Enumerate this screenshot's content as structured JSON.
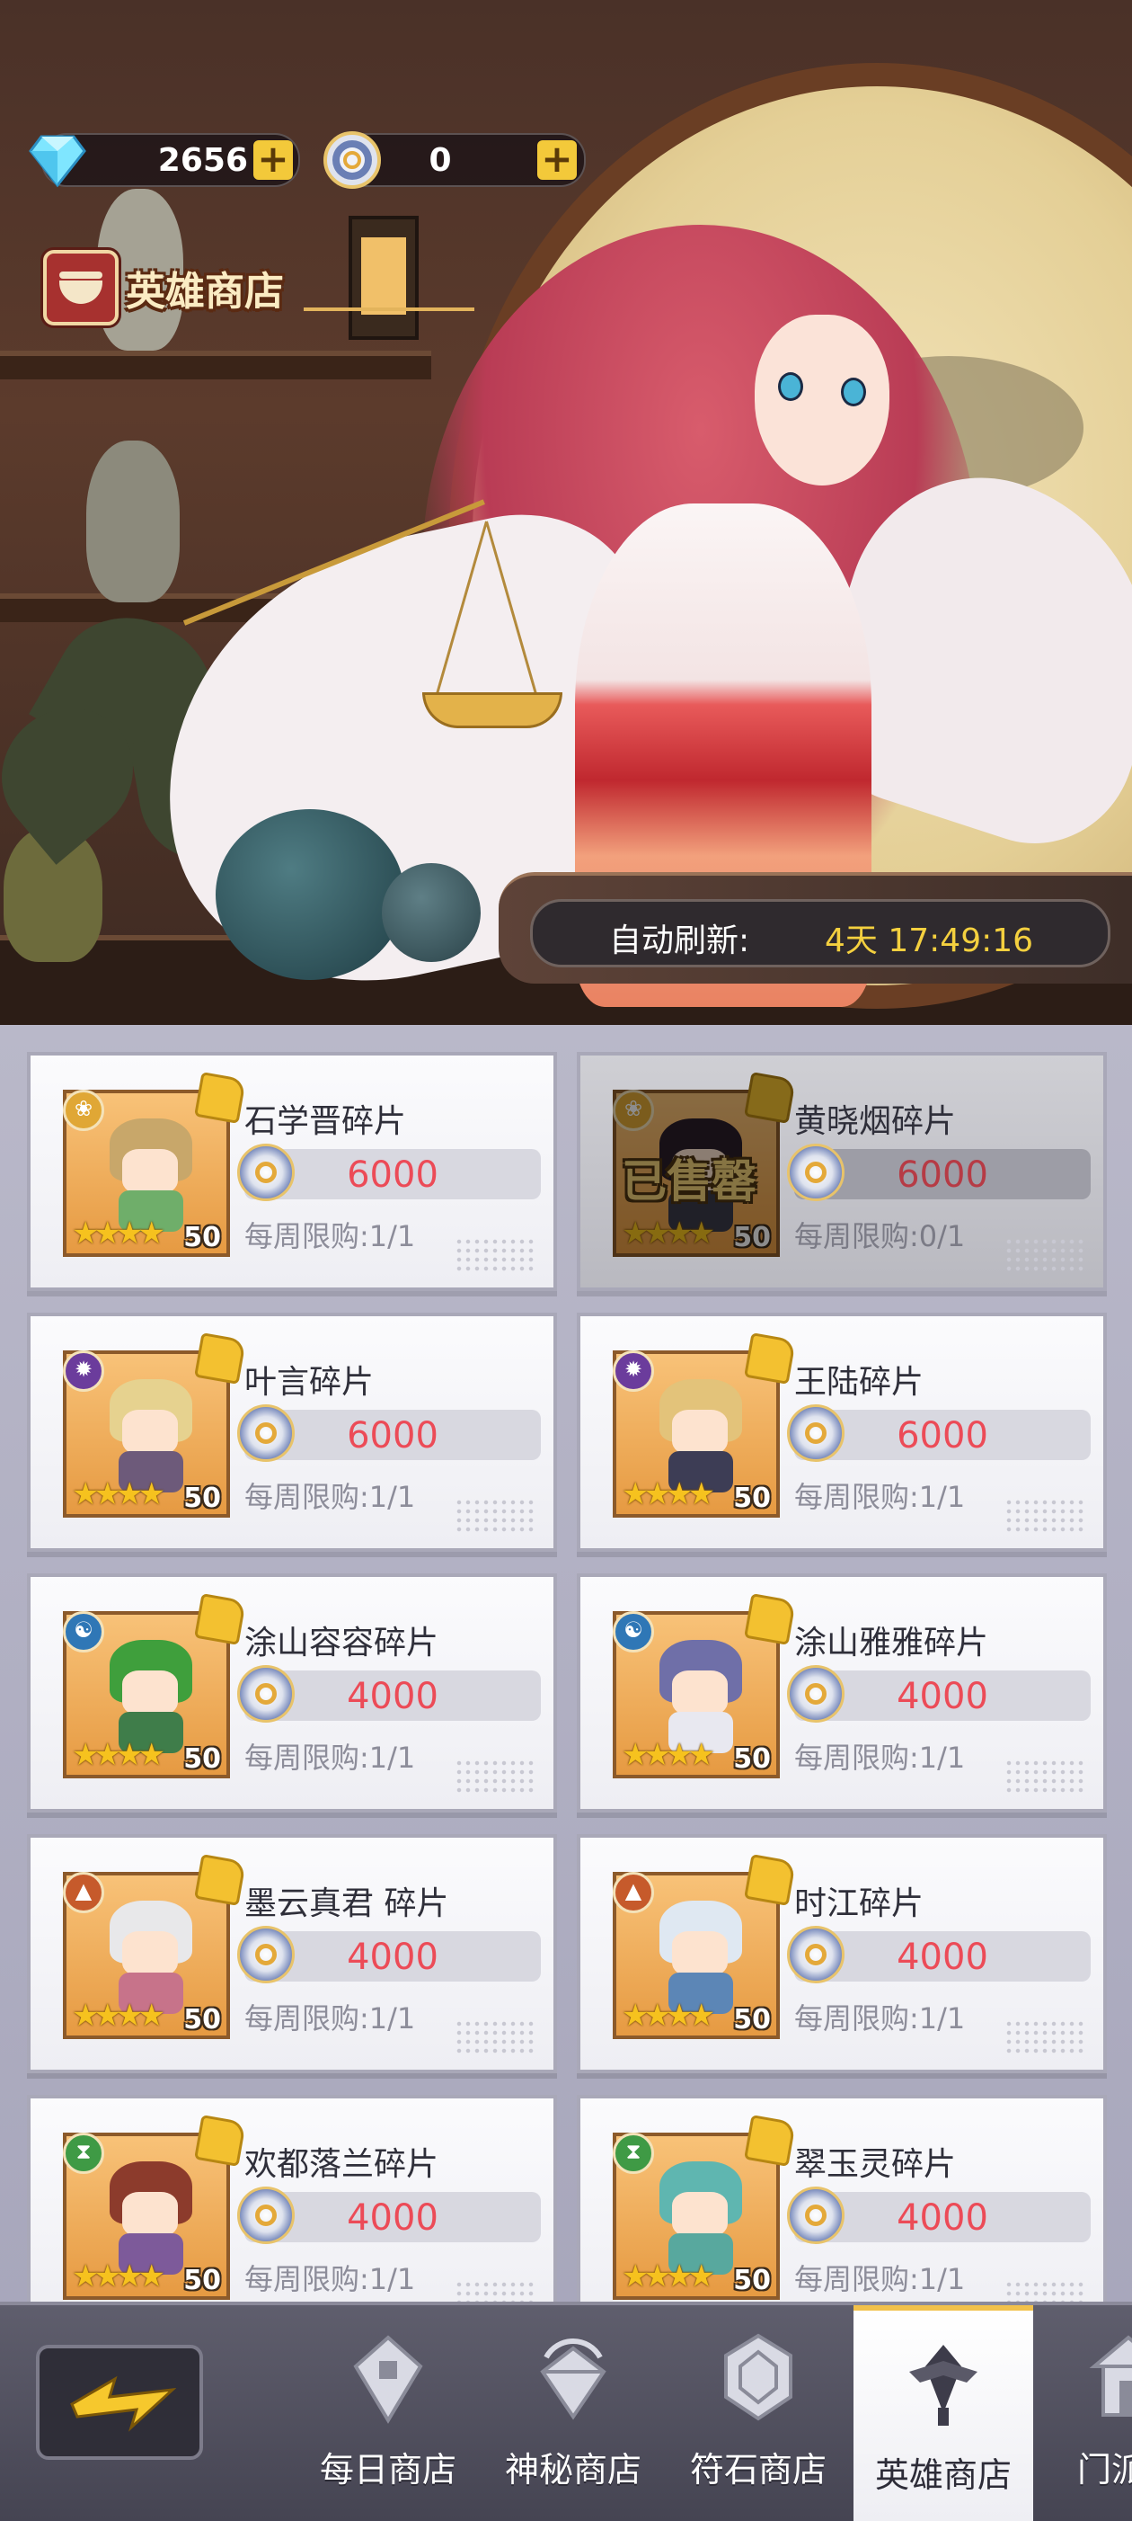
{
  "currency": {
    "gems": "2656",
    "tokens": "0",
    "add_label": "+"
  },
  "shop_title": "英雄商店",
  "refresh": {
    "label": "自动刷新:",
    "time": "4天 17:49:16"
  },
  "items": [
    {
      "name": "石学晋碎片",
      "price": "6000",
      "limit": "每周限购:1/1",
      "level": "50",
      "stars": "★★★★",
      "faction": "lotus",
      "sold": false
    },
    {
      "name": "黄晓烟碎片",
      "price": "6000",
      "limit": "每周限购:0/1",
      "level": "50",
      "stars": "★★★★",
      "faction": "lotus",
      "sold": true,
      "sold_label": "已售罄"
    },
    {
      "name": "叶言碎片",
      "price": "6000",
      "limit": "每周限购:1/1",
      "level": "50",
      "stars": "★★★★",
      "faction": "flame",
      "sold": false
    },
    {
      "name": "王陆碎片",
      "price": "6000",
      "limit": "每周限购:1/1",
      "level": "50",
      "stars": "★★★★",
      "faction": "flame",
      "sold": false
    },
    {
      "name": "涂山容容碎片",
      "price": "4000",
      "limit": "每周限购:1/1",
      "level": "50",
      "stars": "★★★★",
      "faction": "yinyang",
      "sold": false
    },
    {
      "name": "涂山雅雅碎片",
      "price": "4000",
      "limit": "每周限购:1/1",
      "level": "50",
      "stars": "★★★★",
      "faction": "yinyang",
      "sold": false
    },
    {
      "name": "墨云真君 碎片",
      "price": "4000",
      "limit": "每周限购:1/1",
      "level": "50",
      "stars": "★★★★",
      "faction": "mountain",
      "sold": false
    },
    {
      "name": "时江碎片",
      "price": "4000",
      "limit": "每周限购:1/1",
      "level": "50",
      "stars": "★★★★",
      "faction": "mountain",
      "sold": false
    },
    {
      "name": "欢都落兰碎片",
      "price": "4000",
      "limit": "每周限购:1/1",
      "level": "50",
      "stars": "★★★★",
      "faction": "hourglass",
      "sold": false
    },
    {
      "name": "翠玉灵碎片",
      "price": "4000",
      "limit": "每周限购:1/1",
      "level": "50",
      "stars": "★★★★",
      "faction": "hourglass",
      "sold": false
    }
  ],
  "nav": [
    {
      "label": "每日商店",
      "icon": "daily-shop-icon",
      "active": false
    },
    {
      "label": "神秘商店",
      "icon": "mystery-shop-icon",
      "active": false
    },
    {
      "label": "符石商店",
      "icon": "rune-shop-icon",
      "active": false
    },
    {
      "label": "英雄商店",
      "icon": "hero-shop-icon",
      "active": true
    },
    {
      "label": "门派商",
      "icon": "sect-shop-icon",
      "active": false
    }
  ],
  "colors": {
    "price": "#ec4b57",
    "refresh_time": "#f4d03f",
    "tab_highlight": "#f2c14a",
    "plus_button": "#f3c93a"
  }
}
